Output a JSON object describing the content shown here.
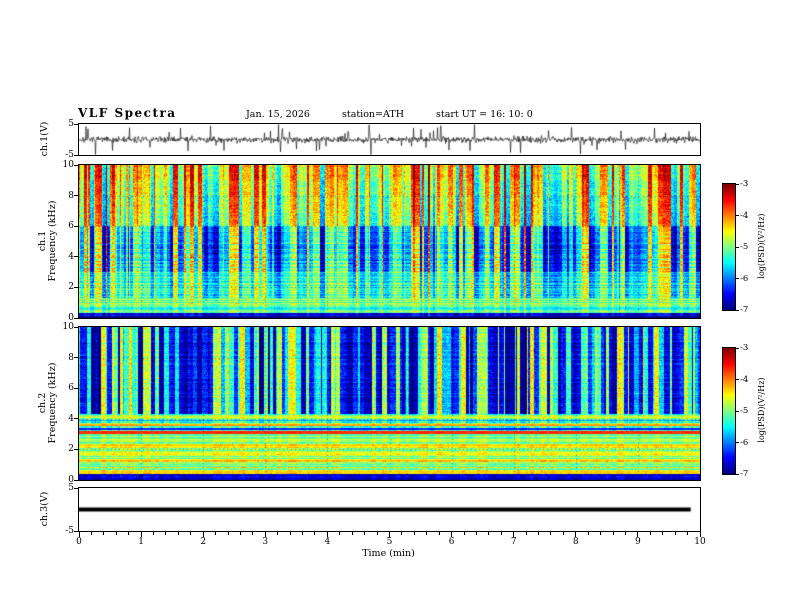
{
  "header": {
    "title": "VLF Spectra",
    "date": "Jan. 15, 2026",
    "station": "station=ATH",
    "start_ut": "start UT =  16: 10: 0"
  },
  "x_axis": {
    "label": "Time (min)",
    "min": 0,
    "max": 10,
    "major_ticks": [
      0,
      1,
      2,
      3,
      4,
      5,
      6,
      7,
      8,
      9,
      10
    ],
    "minor_step": 0.2
  },
  "panels": [
    {
      "id": "ch1_waveform",
      "ylabel": "ch.1(V)",
      "ylim": [
        -5,
        5
      ],
      "yticks": [
        5,
        -5
      ]
    },
    {
      "id": "ch1_spectrogram",
      "ylabel_lines": [
        "ch.1",
        "Frequency (kHz)"
      ],
      "ylim": [
        0,
        10
      ],
      "yticks": [
        0,
        2,
        4,
        6,
        8,
        10
      ]
    },
    {
      "id": "ch2_spectrogram",
      "ylabel_lines": [
        "ch.2",
        "Frequency (kHz)"
      ],
      "ylim": [
        0,
        10
      ],
      "yticks": [
        0,
        2,
        4,
        6,
        8,
        10
      ]
    },
    {
      "id": "ch3_waveform",
      "ylabel": "ch.3(V)",
      "ylim": [
        -5,
        5
      ],
      "yticks": [
        5,
        -5
      ]
    }
  ],
  "colorbars": [
    {
      "id": "cb1",
      "label": "log(PSD)(V²/Hz)",
      "ticks": [
        -3,
        -4,
        -5,
        -6,
        -7
      ],
      "zlim": [
        -7,
        -3
      ]
    },
    {
      "id": "cb2",
      "label": "log(PSD)(V²/Hz)",
      "ticks": [
        -3,
        -4,
        -5,
        -6,
        -7
      ],
      "zlim": [
        -7,
        -3
      ]
    }
  ],
  "chart_data": [
    {
      "type": "line",
      "panel": "ch1_waveform",
      "title": "ch.1 raw waveform",
      "xlim": [
        0,
        10
      ],
      "ylim": [
        -5,
        5
      ],
      "description": "continuous broadband noise centered on 0 V, typical amplitude about ±1 V, frequent impulsive sferic spikes reaching ±4 to ±5 V across the whole 10 minutes",
      "noise": {
        "sigma": 0.5,
        "spike_prob": 0.05,
        "spike_min": 1.5,
        "spike_max": 4.8
      },
      "seed": 7
    },
    {
      "type": "heatmap",
      "panel": "ch1_spectrogram",
      "xlim": [
        0,
        10
      ],
      "ylim": [
        0,
        10
      ],
      "zlim": [
        -7,
        -3
      ],
      "zlabel": "log(PSD)(V²/Hz)",
      "description": "ch.1 spectrogram: green/yellow broadband power above 6 kHz with red impulsive vertical streaks, mixed cyan/blue striated region 3-6 kHz with vertical blue dropouts, cyan-green banding 0.3-3 kHz, dark band below 0.3 kHz",
      "streak_mode": "balanced",
      "seed": 101,
      "bands": [
        {
          "f0": 0.0,
          "f1": 0.35,
          "level": -6.6,
          "row_noise": 0.2,
          "pix_noise": 0.2,
          "streak": 0.3,
          "bias": 0
        },
        {
          "f0": 0.35,
          "f1": 1.3,
          "level": -4.9,
          "row_noise": 0.45,
          "pix_noise": 0.3,
          "streak": 0.3,
          "bias": 0
        },
        {
          "f0": 1.3,
          "f1": 3.0,
          "level": -5.2,
          "row_noise": 0.3,
          "pix_noise": 0.3,
          "streak": 0.8,
          "bias": 0
        },
        {
          "f0": 3.0,
          "f1": 6.0,
          "level": -5.3,
          "row_noise": 0.28,
          "pix_noise": 0.3,
          "streak": 1.4,
          "bias": -0.2
        },
        {
          "f0": 6.0,
          "f1": 10.01,
          "level": -5.0,
          "row_noise": 0.15,
          "pix_noise": 0.35,
          "streak": 1.2,
          "bias": 0.1,
          "grad": 0.6
        }
      ],
      "lines": [
        {
          "f": 0.08,
          "level": -7.0,
          "w": 2,
          "a": 0.9
        },
        {
          "f": 0.6,
          "level": -6.2,
          "w": 1,
          "a": 0.5
        },
        {
          "f": 1.0,
          "level": -5.6,
          "w": 1,
          "a": 0.4
        },
        {
          "f": 3.3,
          "level": -6.2,
          "w": 1,
          "a": 0.35
        },
        {
          "f": 3.8,
          "level": -6.2,
          "w": 1,
          "a": 0.35
        },
        {
          "f": 4.3,
          "level": -6.2,
          "w": 1,
          "a": 0.3
        },
        {
          "f": 4.8,
          "level": -6.2,
          "w": 1,
          "a": 0.3
        },
        {
          "f": 5.3,
          "level": -6.2,
          "w": 1,
          "a": 0.3
        }
      ],
      "grid_y": [
        2,
        4,
        6,
        8
      ],
      "grid_x": [
        1,
        2,
        3,
        4,
        5,
        6,
        7,
        8,
        9
      ]
    },
    {
      "type": "heatmap",
      "panel": "ch2_spectrogram",
      "xlim": [
        0,
        10
      ],
      "ylim": [
        0,
        10
      ],
      "zlim": [
        -7,
        -3
      ],
      "zlabel": "log(PSD)(V²/Hz)",
      "description": "ch.2 spectrogram: dark-blue vertical dropout columns dominate above 4.3 kHz with green between, strong horizontal red line near 3.1 kHz and dark line near 3.35 kHz, green/yellow horizontally banded power 0.4-3 kHz with several red lines, dark band below 0.4 kHz",
      "streak_mode": "dark",
      "seed": 202,
      "bands": [
        {
          "f0": 0.0,
          "f1": 0.4,
          "level": -6.6,
          "row_noise": 0.2,
          "pix_noise": 0.2,
          "streak": 0.2,
          "bias": 0
        },
        {
          "f0": 0.4,
          "f1": 3.0,
          "level": -4.7,
          "row_noise": 0.5,
          "pix_noise": 0.25,
          "streak": 0.2,
          "bias": 0
        },
        {
          "f0": 3.0,
          "f1": 4.3,
          "level": -5.0,
          "row_noise": 0.35,
          "pix_noise": 0.3,
          "streak": 0.4,
          "bias": 0
        },
        {
          "f0": 4.3,
          "f1": 10.01,
          "level": -5.2,
          "row_noise": 0.2,
          "pix_noise": 0.3,
          "streak": 1.6,
          "bias": -0.2
        }
      ],
      "lines": [
        {
          "f": 0.55,
          "level": -4.2,
          "w": 2,
          "a": 0.6
        },
        {
          "f": 0.9,
          "level": -6.2,
          "w": 1,
          "a": 0.5
        },
        {
          "f": 1.3,
          "level": -4.1,
          "w": 2,
          "a": 0.55
        },
        {
          "f": 1.75,
          "level": -4.3,
          "w": 1,
          "a": 0.5
        },
        {
          "f": 2.2,
          "level": -4.0,
          "w": 2,
          "a": 0.55
        },
        {
          "f": 2.65,
          "level": -4.2,
          "w": 1,
          "a": 0.5
        },
        {
          "f": 3.1,
          "level": -3.4,
          "w": 3,
          "a": 0.85
        },
        {
          "f": 3.35,
          "level": -6.7,
          "w": 2,
          "a": 0.8
        },
        {
          "f": 3.6,
          "level": -3.8,
          "w": 2,
          "a": 0.7
        },
        {
          "f": 3.9,
          "level": -6.4,
          "w": 1,
          "a": 0.5
        },
        {
          "f": 4.1,
          "level": -4.2,
          "w": 2,
          "a": 0.5
        }
      ],
      "grid_y": [
        2,
        4,
        6,
        8
      ],
      "grid_x": [
        1,
        2,
        3,
        4,
        5,
        6,
        7,
        8,
        9
      ]
    },
    {
      "type": "line",
      "panel": "ch3_waveform",
      "title": "ch.3 raw waveform",
      "xlim": [
        0,
        10
      ],
      "ylim": [
        -5,
        5
      ],
      "description": "flat thick black trace at 0 V for the whole record (channel off / no signal), ending near 9.85 min",
      "flat_value": 0,
      "x_end": 9.85,
      "line_width": 4,
      "seed": 9
    }
  ]
}
